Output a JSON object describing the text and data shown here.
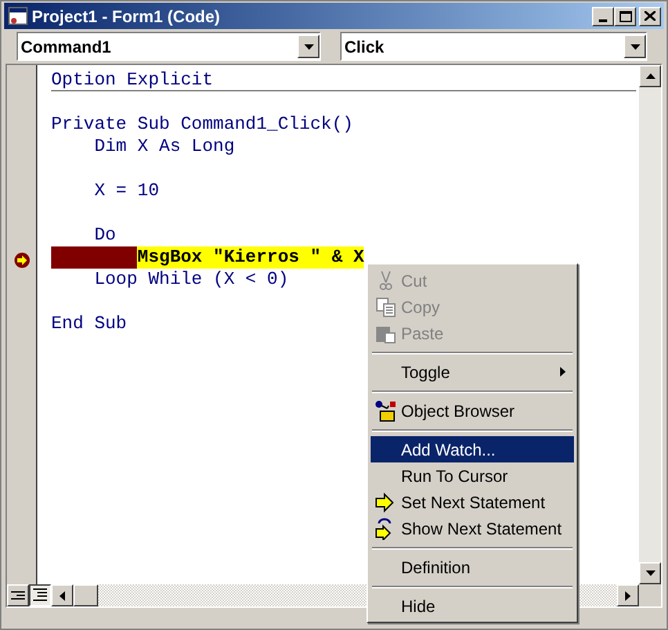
{
  "window": {
    "title": "Project1 - Form1 (Code)"
  },
  "object_combo": {
    "value": "Command1"
  },
  "procedure_combo": {
    "value": "Click"
  },
  "code_lines": [
    {
      "text": "Option Explicit",
      "kind": "declaration"
    },
    {
      "kind": "blank"
    },
    {
      "text": "Private Sub Command1_Click()",
      "kind": "code"
    },
    {
      "text": "    Dim X As Long",
      "kind": "code"
    },
    {
      "kind": "blank"
    },
    {
      "text": "    X = 10",
      "kind": "code"
    },
    {
      "kind": "blank"
    },
    {
      "text": "    Do",
      "kind": "code"
    },
    {
      "text": "        MsgBox \"Kierros \" & X",
      "kind": "current"
    },
    {
      "text": "    Loop While (X < 0)",
      "kind": "code"
    },
    {
      "kind": "blank"
    },
    {
      "text": "End Sub",
      "kind": "code"
    }
  ],
  "context_menu": [
    {
      "kind": "cut",
      "label": "Cut",
      "disabled": true,
      "selected": false
    },
    {
      "kind": "copy",
      "label": "Copy",
      "disabled": true,
      "selected": false
    },
    {
      "kind": "paste",
      "label": "Paste",
      "disabled": true,
      "selected": false
    },
    {
      "kind": "separator"
    },
    {
      "kind": "submenu",
      "label": "Toggle",
      "disabled": false,
      "selected": false
    },
    {
      "kind": "separator"
    },
    {
      "kind": "object-browser",
      "label": "Object Browser",
      "disabled": false,
      "selected": false
    },
    {
      "kind": "separator"
    },
    {
      "kind": "plain",
      "label": "Add Watch...",
      "disabled": false,
      "selected": true
    },
    {
      "kind": "plain",
      "label": "Run To Cursor",
      "disabled": false,
      "selected": false
    },
    {
      "kind": "set-next",
      "label": "Set Next Statement",
      "disabled": false,
      "selected": false
    },
    {
      "kind": "show-next",
      "label": "Show Next Statement",
      "disabled": false,
      "selected": false
    },
    {
      "kind": "separator"
    },
    {
      "kind": "plain",
      "label": "Definition",
      "disabled": false,
      "selected": false
    },
    {
      "kind": "separator"
    },
    {
      "kind": "plain",
      "label": "Hide",
      "disabled": false,
      "selected": false
    }
  ]
}
